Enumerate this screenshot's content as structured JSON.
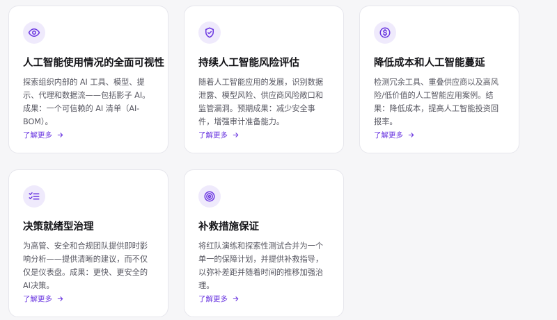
{
  "colors": {
    "accent": "#6a36e0",
    "icon_bg": "#efeafc"
  },
  "cards": [
    {
      "icon": "eye-icon",
      "title": "人工智能使用情况的全面可视性",
      "description": "探索组织内部的 AI 工具、模型、提示、代理和数据流——包括影子 AI。成果：一个可信赖的 AI 清单（AI-BOM）。",
      "link": "了解更多"
    },
    {
      "icon": "shield-check-icon",
      "title": "持续人工智能风险评估",
      "description": "随着人工智能应用的发展，识别数据泄露、模型风险、供应商风险敞口和监管漏洞。预期成果：减少安全事件，增强审计准备能力。",
      "link": "了解更多"
    },
    {
      "icon": "dollar-icon",
      "title": "降低成本和人工智能蔓延",
      "description": "检测冗余工具、重叠供应商以及高风险/低价值的人工智能应用案例。结果：降低成本，提高人工智能投资回报率。",
      "link": "了解更多"
    },
    {
      "icon": "checklist-icon",
      "title": "决策就绪型治理",
      "description": "为高管、安全和合规团队提供即时影响分析——提供清晰的建议，而不仅仅是仪表盘。成果：更快、更安全的AI决策。",
      "link": "了解更多"
    },
    {
      "icon": "target-icon",
      "title": "补救措施保证",
      "description": "将红队演练和探索性测试合并为一个单一的保障计划，并提供补救指导，以弥补差距并随着时间的推移加强治理。",
      "link": "了解更多"
    }
  ]
}
